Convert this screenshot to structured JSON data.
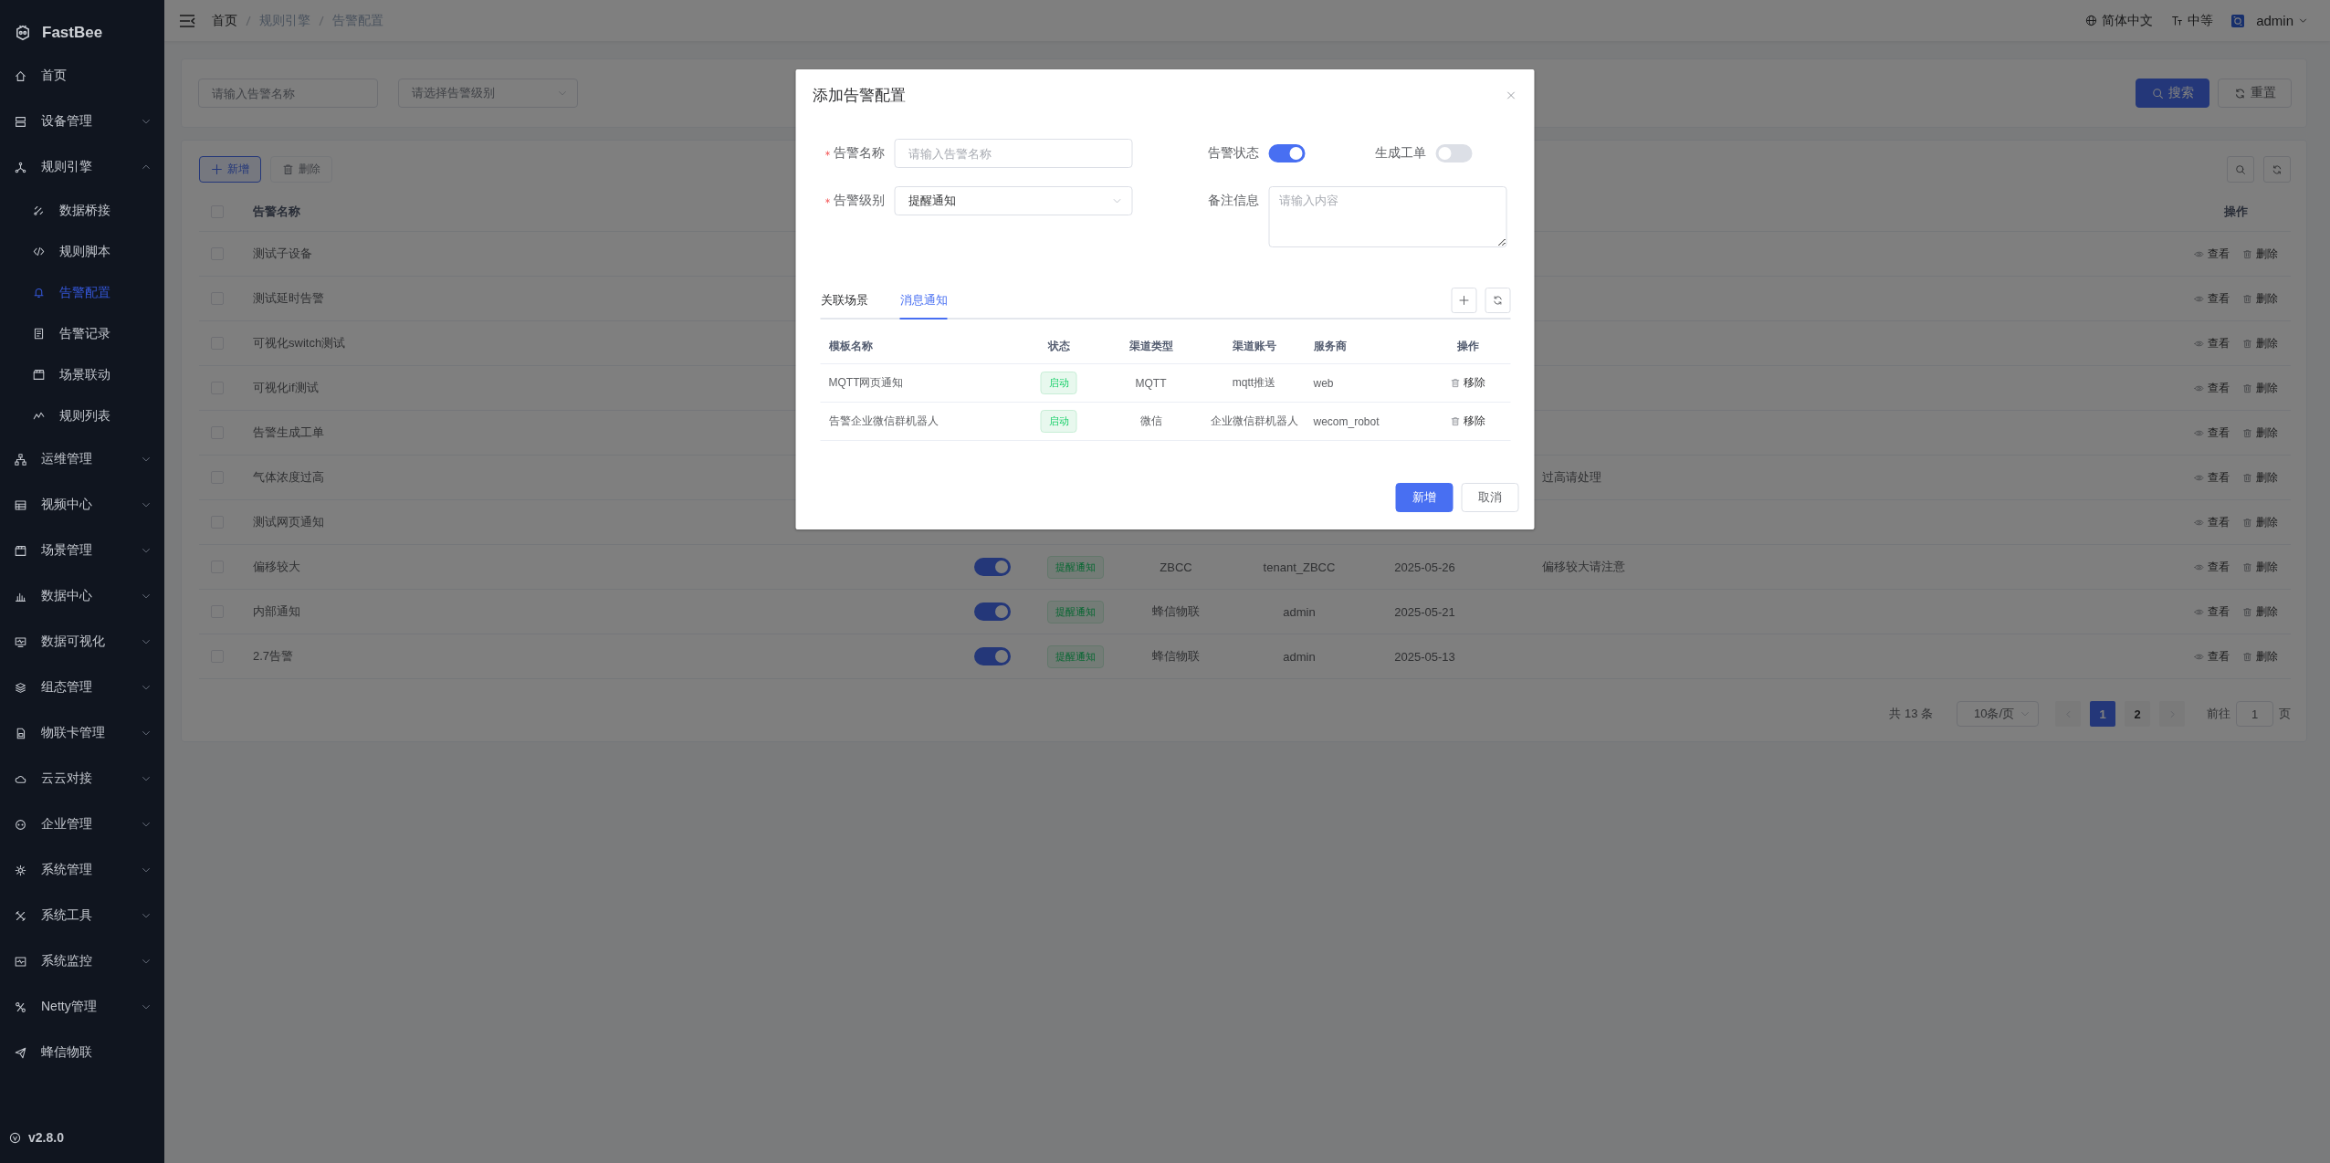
{
  "sidebar": {
    "logo": "FastBee",
    "items": [
      {
        "label": "首页",
        "kind": "link"
      },
      {
        "label": "设备管理",
        "kind": "group",
        "expanded": false
      },
      {
        "label": "规则引擎",
        "kind": "group",
        "expanded": true,
        "children": [
          {
            "label": "数据桥接",
            "selected": false
          },
          {
            "label": "规则脚本",
            "selected": false
          },
          {
            "label": "告警配置",
            "selected": true
          },
          {
            "label": "告警记录",
            "selected": false
          },
          {
            "label": "场景联动",
            "selected": false
          },
          {
            "label": "规则列表",
            "selected": false
          }
        ]
      },
      {
        "label": "运维管理",
        "kind": "group",
        "expanded": false
      },
      {
        "label": "视频中心",
        "kind": "group",
        "expanded": false
      },
      {
        "label": "场景管理",
        "kind": "group",
        "expanded": false
      },
      {
        "label": "数据中心",
        "kind": "group",
        "expanded": false
      },
      {
        "label": "数据可视化",
        "kind": "group",
        "expanded": false
      },
      {
        "label": "组态管理",
        "kind": "group",
        "expanded": false
      },
      {
        "label": "物联卡管理",
        "kind": "group",
        "expanded": false
      },
      {
        "label": "云云对接",
        "kind": "group",
        "expanded": false
      },
      {
        "label": "企业管理",
        "kind": "group",
        "expanded": false
      },
      {
        "label": "系统管理",
        "kind": "group",
        "expanded": false
      },
      {
        "label": "系统工具",
        "kind": "group",
        "expanded": false
      },
      {
        "label": "系统监控",
        "kind": "group",
        "expanded": false
      },
      {
        "label": "Netty管理",
        "kind": "group",
        "expanded": false
      },
      {
        "label": "蜂信物联",
        "kind": "link"
      }
    ],
    "version": "v2.8.0"
  },
  "topbar": {
    "breadcrumb": [
      "首页",
      "规则引擎",
      "告警配置"
    ],
    "language": "简体中文",
    "size": "中等",
    "user": "admin"
  },
  "search": {
    "name_placeholder": "请输入告警名称",
    "level_placeholder": "请选择告警级别",
    "buttons": [
      "搜索",
      "重置"
    ]
  },
  "toolbar": {
    "add": "新增",
    "delete": {
      "label": "删除",
      "disabled": true
    }
  },
  "table": {
    "all_checked": false,
    "columns": [
      "告警名称",
      "操作"
    ],
    "rows": [
      {
        "checked": false,
        "name": "测试子设备",
        "actions": [
          "查看",
          "删除"
        ]
      },
      {
        "checked": false,
        "name": "测试延时告警",
        "actions": [
          "查看",
          "删除"
        ]
      },
      {
        "checked": false,
        "name": "可视化switch测试",
        "actions": [
          "查看",
          "删除"
        ]
      },
      {
        "checked": false,
        "name": "可视化if测试",
        "actions": [
          "查看",
          "删除"
        ]
      },
      {
        "checked": false,
        "name": "告警生成工单",
        "actions": [
          "查看",
          "删除"
        ]
      },
      {
        "checked": false,
        "name": "气体浓度过高",
        "remark": "过高请处理",
        "actions": [
          "查看",
          "删除"
        ]
      },
      {
        "checked": false,
        "name": "测试网页通知",
        "actions": [
          "查看",
          "删除"
        ]
      },
      {
        "checked": false,
        "name": "偏移较大",
        "enabled": true,
        "tag": "提醒通知",
        "column_5": "ZBCC",
        "column_6": "tenant_ZBCC",
        "date": "2025-05-26",
        "remark": "偏移较大请注意",
        "actions": [
          "查看",
          "删除"
        ]
      },
      {
        "checked": false,
        "name": "内部通知",
        "enabled": true,
        "tag": "提醒通知",
        "column_5": "蜂信物联",
        "column_6": "admin",
        "date": "2025-05-21",
        "actions": [
          "查看",
          "删除"
        ]
      },
      {
        "checked": false,
        "name": "2.7告警",
        "enabled": true,
        "tag": "提醒通知",
        "column_5": "蜂信物联",
        "column_6": "admin",
        "date": "2025-05-13",
        "actions": [
          "查看",
          "删除"
        ]
      }
    ]
  },
  "pagination": {
    "total": "共 13 条",
    "page_size": "10条/页",
    "pages": [
      {
        "label": "1",
        "selected": true
      },
      {
        "label": "2",
        "selected": false
      }
    ],
    "goto_label": "前往",
    "goto_value": "1",
    "goto_suffix": "页"
  },
  "dialog": {
    "title": "添加告警配置",
    "name": {
      "label": "告警名称",
      "required": true,
      "placeholder": "请输入告警名称"
    },
    "status": {
      "label": "告警状态",
      "on": true
    },
    "work_order": {
      "label": "生成工单",
      "on": false
    },
    "alert_level": {
      "label": "告警级别",
      "required": true,
      "value": "提醒通知"
    },
    "remark": {
      "label": "备注信息",
      "placeholder": "请输入内容"
    },
    "tabs": [
      {
        "label": "关联场景",
        "selected": false
      },
      {
        "label": "消息通知",
        "selected": true
      }
    ],
    "columns": [
      "模板名称",
      "状态",
      "渠道类型",
      "渠道账号",
      "服务商",
      "操作"
    ],
    "rows": [
      {
        "template": "MQTT网页通知",
        "status": "启动",
        "channel_type": "MQTT",
        "channel_account": "mqtt推送",
        "provider": "web",
        "action": "移除"
      },
      {
        "template": "告警企业微信群机器人",
        "status": "启动",
        "channel_type": "微信",
        "channel_account": "企业微信群机器人",
        "provider": "wecom_robot",
        "action": "移除"
      }
    ],
    "buttons": [
      {
        "label": "新增",
        "kind": "primary"
      },
      {
        "label": "取消",
        "kind": "default"
      }
    ]
  }
}
